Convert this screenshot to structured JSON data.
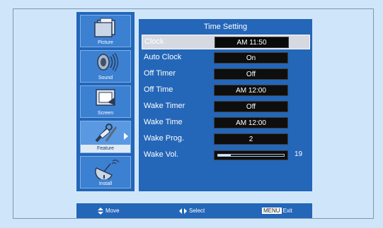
{
  "sidebar": {
    "items": [
      {
        "label": "Picture",
        "icon": "picture-icon"
      },
      {
        "label": "Sound",
        "icon": "sound-icon"
      },
      {
        "label": "Screen",
        "icon": "screen-icon"
      },
      {
        "label": "Feature",
        "icon": "feature-icon",
        "selected": true
      },
      {
        "label": "Install",
        "icon": "install-icon"
      }
    ]
  },
  "panel": {
    "title": "Time Setting",
    "rows": [
      {
        "label": "Clock",
        "value": "AM 11:50",
        "highlighted": true
      },
      {
        "label": "Auto Clock",
        "value": "On"
      },
      {
        "label": "Off Timer",
        "value": "Off"
      },
      {
        "label": "Off Time",
        "value": "AM 12:00"
      },
      {
        "label": "Wake Timer",
        "value": "Off"
      },
      {
        "label": "Wake Time",
        "value": "AM 12:00"
      },
      {
        "label": "Wake Prog.",
        "value": "2"
      },
      {
        "label": "Wake Vol.",
        "value": "19",
        "level": 0.19
      }
    ]
  },
  "footer": {
    "move_label": "Move",
    "select_label": "Select",
    "menu_key": "MENU",
    "exit_label": "Exit"
  },
  "colors": {
    "background": "#cfe6fa",
    "panel": "#2466b8",
    "value_box": "#0e0e0e",
    "highlight": "#d6d9e1"
  }
}
